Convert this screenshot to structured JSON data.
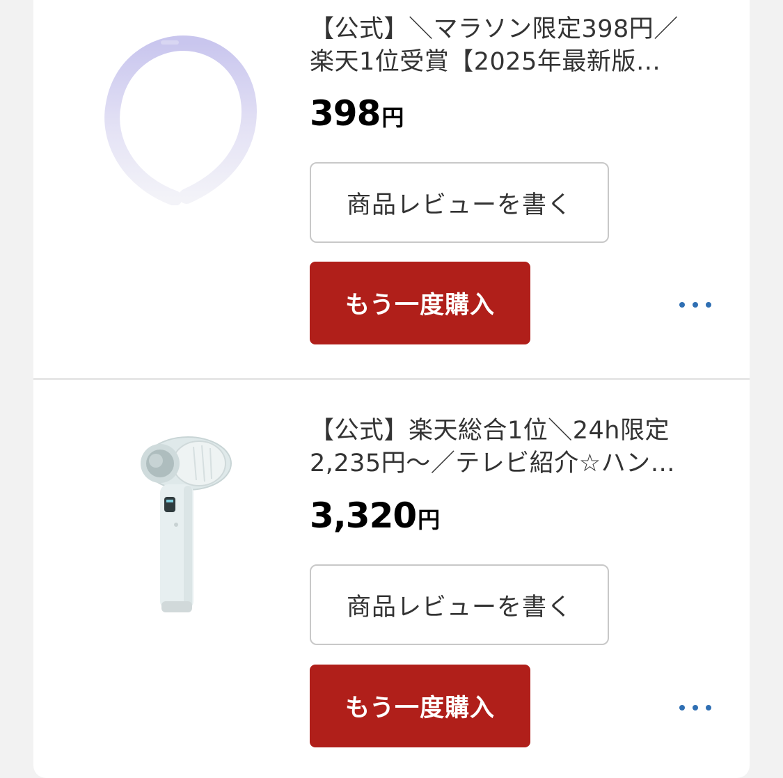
{
  "items": [
    {
      "title": "【公式】＼マラソン限定398円／\n楽天1位受賞【2025年最新版…",
      "price": "398",
      "currency": "円",
      "review_label": "商品レビューを書く",
      "rebuy_label": "もう一度購入",
      "image_icon": "neck-cooling-ring-image",
      "more_icon": "more-dots-icon"
    },
    {
      "title": "【公式】楽天総合1位＼24h限定\n2,235円～／テレビ紹介☆ハン…",
      "price": "3,320",
      "currency": "円",
      "review_label": "商品レビューを書く",
      "rebuy_label": "もう一度購入",
      "image_icon": "handheld-fan-image",
      "more_icon": "more-dots-icon"
    }
  ],
  "colors": {
    "accent_button": "#b01f1a",
    "more_dots": "#2f6fb3",
    "background": "#f2f2f2"
  }
}
